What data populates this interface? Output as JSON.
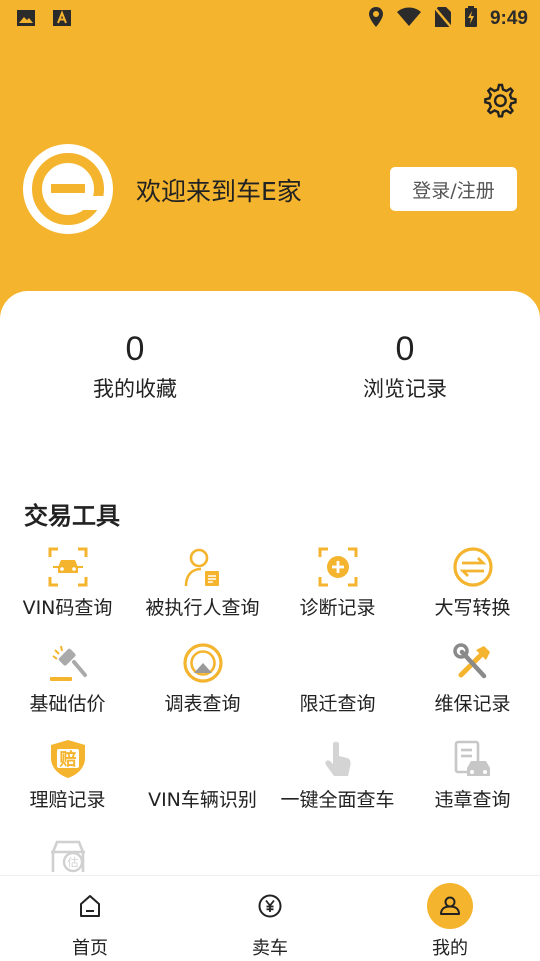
{
  "status_bar": {
    "time": "9:49"
  },
  "header": {
    "welcome_text": "欢迎来到车E家",
    "login_button": "登录/注册"
  },
  "stats": [
    {
      "value": "0",
      "label": "我的收藏"
    },
    {
      "value": "0",
      "label": "浏览记录"
    }
  ],
  "tools_section": {
    "title": "交易工具",
    "items": [
      {
        "label": "VIN码查询",
        "icon": "car-scan-icon"
      },
      {
        "label": "被执行人查询",
        "icon": "person-document-icon"
      },
      {
        "label": "诊断记录",
        "icon": "diagnosis-icon"
      },
      {
        "label": "大写转换",
        "icon": "convert-icon"
      },
      {
        "label": "基础估价",
        "icon": "gavel-icon"
      },
      {
        "label": "调表查询",
        "icon": "odometer-icon"
      },
      {
        "label": "限迁查询",
        "icon": ""
      },
      {
        "label": "维保记录",
        "icon": "tools-icon"
      },
      {
        "label": "理赔记录",
        "icon": "insurance-claim-icon"
      },
      {
        "label": "VIN车辆识别",
        "icon": ""
      },
      {
        "label": "一键全面查车",
        "icon": "tap-icon"
      },
      {
        "label": "违章查询",
        "icon": "violation-icon"
      },
      {
        "label": "",
        "icon": "car-valuation-icon"
      }
    ]
  },
  "bottom_nav": [
    {
      "label": "首页",
      "icon": "home-icon"
    },
    {
      "label": "卖车",
      "icon": "yen-icon"
    },
    {
      "label": "我的",
      "icon": "user-icon"
    }
  ],
  "colors": {
    "accent": "#F4B42E",
    "card": "#FFFFFF",
    "text": "#222222",
    "icon_gray": "#BDBDBD"
  }
}
